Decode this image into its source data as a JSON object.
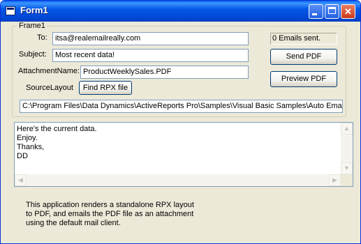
{
  "window": {
    "title": "Form1",
    "icon": "app-icon"
  },
  "frame": {
    "legend": "Frame1",
    "to_label": "To:",
    "to_value": "itsa@realemailreally.com",
    "subject_label": "Subject:",
    "subject_value": "Most recent data!",
    "attachment_label": "AttachmentName:",
    "attachment_value": "ProductWeeklySales.PDF",
    "source_label": "SourceLayout",
    "find_button": "Find RPX file",
    "path_value": "C:\\Program Files\\Data Dynamics\\ActiveReports Pro\\Samples\\Visual Basic Samples\\Auto Email f"
  },
  "status": {
    "emails_sent": "0 Emails sent."
  },
  "buttons": {
    "send_pdf": "Send PDF",
    "preview_pdf": "Preview PDF"
  },
  "memo": {
    "body": "Here's the current data.\nEnjoy.\nThanks,\nDD"
  },
  "description": "This application renders a standalone RPX layout to PDF, and emails the PDF file as an attachment using the default mail client.",
  "colors": {
    "titlebar": "#0558E6",
    "window_face": "#ECE9D8",
    "border": "#7F9DB9",
    "close_button": "#C8391A"
  }
}
